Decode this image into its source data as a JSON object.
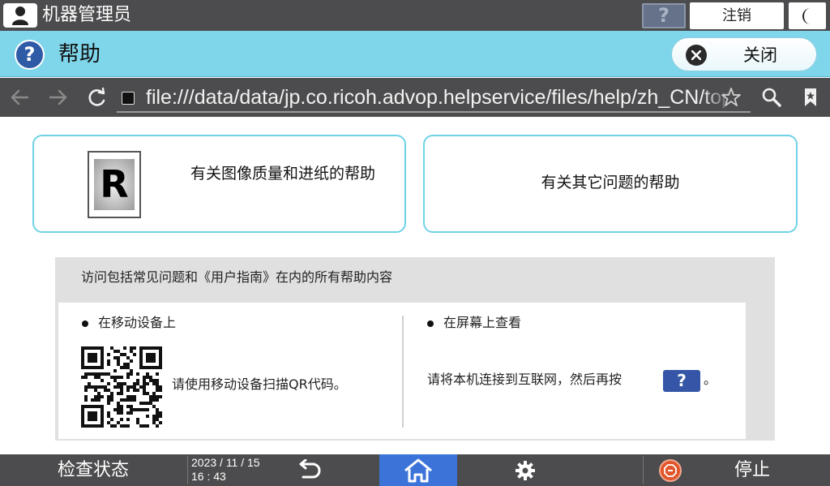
{
  "topbar": {
    "user_name": "机器管理员",
    "help_label": "?",
    "logout_label": "注销",
    "user_icon": "user-icon",
    "moon_icon": "moon-icon"
  },
  "helpbar": {
    "title": "帮助",
    "help_icon_label": "?",
    "close_label": "关闭"
  },
  "browser": {
    "url": "file:///data/data/jp.co.ricoh.advop.helpservice/files/help/zh_CN/top.html?lang"
  },
  "cards": {
    "image_quality": "有关图像质量和进纸的帮助",
    "r_icon_letter": "R",
    "other_issues": "有关其它问题的帮助"
  },
  "panel": {
    "title": "访问包括常见问题和《用户指南》在内的所有帮助内容",
    "mobile_title": "在移动设备上",
    "qr_text": "请使用移动设备扫描QR代码。",
    "screen_title": "在屏幕上查看",
    "connect_text": "请将本机连接到互联网，然后再按",
    "q_button": "?",
    "period": "。"
  },
  "bottombar": {
    "check_status": "检查状态",
    "date": "2023 / 11 / 15",
    "time": "16 : 43",
    "stop_label": "停止"
  },
  "colors": {
    "accent_cyan": "#7fd6ea",
    "dark_bar": "#4c4c4e",
    "home_blue": "#3b73d9",
    "help_blue": "#2f5aa5",
    "stop_red": "#e2562b"
  }
}
